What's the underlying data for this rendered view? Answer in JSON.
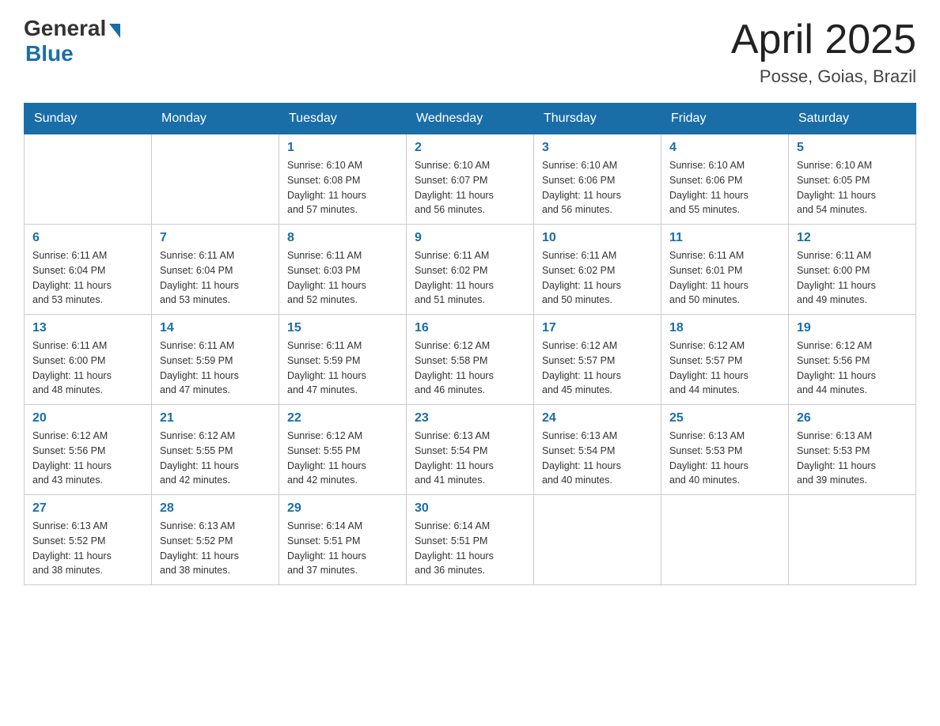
{
  "header": {
    "logo_general": "General",
    "logo_blue": "Blue",
    "month_title": "April 2025",
    "location": "Posse, Goias, Brazil"
  },
  "weekdays": [
    "Sunday",
    "Monday",
    "Tuesday",
    "Wednesday",
    "Thursday",
    "Friday",
    "Saturday"
  ],
  "weeks": [
    [
      {
        "day": "",
        "info": ""
      },
      {
        "day": "",
        "info": ""
      },
      {
        "day": "1",
        "info": "Sunrise: 6:10 AM\nSunset: 6:08 PM\nDaylight: 11 hours\nand 57 minutes."
      },
      {
        "day": "2",
        "info": "Sunrise: 6:10 AM\nSunset: 6:07 PM\nDaylight: 11 hours\nand 56 minutes."
      },
      {
        "day": "3",
        "info": "Sunrise: 6:10 AM\nSunset: 6:06 PM\nDaylight: 11 hours\nand 56 minutes."
      },
      {
        "day": "4",
        "info": "Sunrise: 6:10 AM\nSunset: 6:06 PM\nDaylight: 11 hours\nand 55 minutes."
      },
      {
        "day": "5",
        "info": "Sunrise: 6:10 AM\nSunset: 6:05 PM\nDaylight: 11 hours\nand 54 minutes."
      }
    ],
    [
      {
        "day": "6",
        "info": "Sunrise: 6:11 AM\nSunset: 6:04 PM\nDaylight: 11 hours\nand 53 minutes."
      },
      {
        "day": "7",
        "info": "Sunrise: 6:11 AM\nSunset: 6:04 PM\nDaylight: 11 hours\nand 53 minutes."
      },
      {
        "day": "8",
        "info": "Sunrise: 6:11 AM\nSunset: 6:03 PM\nDaylight: 11 hours\nand 52 minutes."
      },
      {
        "day": "9",
        "info": "Sunrise: 6:11 AM\nSunset: 6:02 PM\nDaylight: 11 hours\nand 51 minutes."
      },
      {
        "day": "10",
        "info": "Sunrise: 6:11 AM\nSunset: 6:02 PM\nDaylight: 11 hours\nand 50 minutes."
      },
      {
        "day": "11",
        "info": "Sunrise: 6:11 AM\nSunset: 6:01 PM\nDaylight: 11 hours\nand 50 minutes."
      },
      {
        "day": "12",
        "info": "Sunrise: 6:11 AM\nSunset: 6:00 PM\nDaylight: 11 hours\nand 49 minutes."
      }
    ],
    [
      {
        "day": "13",
        "info": "Sunrise: 6:11 AM\nSunset: 6:00 PM\nDaylight: 11 hours\nand 48 minutes."
      },
      {
        "day": "14",
        "info": "Sunrise: 6:11 AM\nSunset: 5:59 PM\nDaylight: 11 hours\nand 47 minutes."
      },
      {
        "day": "15",
        "info": "Sunrise: 6:11 AM\nSunset: 5:59 PM\nDaylight: 11 hours\nand 47 minutes."
      },
      {
        "day": "16",
        "info": "Sunrise: 6:12 AM\nSunset: 5:58 PM\nDaylight: 11 hours\nand 46 minutes."
      },
      {
        "day": "17",
        "info": "Sunrise: 6:12 AM\nSunset: 5:57 PM\nDaylight: 11 hours\nand 45 minutes."
      },
      {
        "day": "18",
        "info": "Sunrise: 6:12 AM\nSunset: 5:57 PM\nDaylight: 11 hours\nand 44 minutes."
      },
      {
        "day": "19",
        "info": "Sunrise: 6:12 AM\nSunset: 5:56 PM\nDaylight: 11 hours\nand 44 minutes."
      }
    ],
    [
      {
        "day": "20",
        "info": "Sunrise: 6:12 AM\nSunset: 5:56 PM\nDaylight: 11 hours\nand 43 minutes."
      },
      {
        "day": "21",
        "info": "Sunrise: 6:12 AM\nSunset: 5:55 PM\nDaylight: 11 hours\nand 42 minutes."
      },
      {
        "day": "22",
        "info": "Sunrise: 6:12 AM\nSunset: 5:55 PM\nDaylight: 11 hours\nand 42 minutes."
      },
      {
        "day": "23",
        "info": "Sunrise: 6:13 AM\nSunset: 5:54 PM\nDaylight: 11 hours\nand 41 minutes."
      },
      {
        "day": "24",
        "info": "Sunrise: 6:13 AM\nSunset: 5:54 PM\nDaylight: 11 hours\nand 40 minutes."
      },
      {
        "day": "25",
        "info": "Sunrise: 6:13 AM\nSunset: 5:53 PM\nDaylight: 11 hours\nand 40 minutes."
      },
      {
        "day": "26",
        "info": "Sunrise: 6:13 AM\nSunset: 5:53 PM\nDaylight: 11 hours\nand 39 minutes."
      }
    ],
    [
      {
        "day": "27",
        "info": "Sunrise: 6:13 AM\nSunset: 5:52 PM\nDaylight: 11 hours\nand 38 minutes."
      },
      {
        "day": "28",
        "info": "Sunrise: 6:13 AM\nSunset: 5:52 PM\nDaylight: 11 hours\nand 38 minutes."
      },
      {
        "day": "29",
        "info": "Sunrise: 6:14 AM\nSunset: 5:51 PM\nDaylight: 11 hours\nand 37 minutes."
      },
      {
        "day": "30",
        "info": "Sunrise: 6:14 AM\nSunset: 5:51 PM\nDaylight: 11 hours\nand 36 minutes."
      },
      {
        "day": "",
        "info": ""
      },
      {
        "day": "",
        "info": ""
      },
      {
        "day": "",
        "info": ""
      }
    ]
  ]
}
